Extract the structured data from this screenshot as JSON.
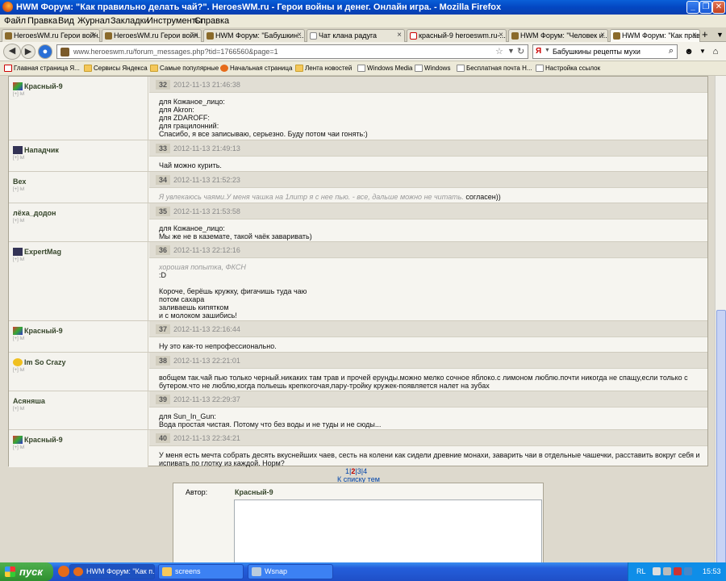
{
  "window": {
    "title": "HWM Форум: \"Как правильно делать чай?\". HeroesWM.ru - Герои войны и денег. Онлайн игра. - Mozilla Firefox"
  },
  "menu": [
    "Файл",
    "Правка",
    "Вид",
    "Журнал",
    "Закладки",
    "Инструменты",
    "Справка"
  ],
  "tabs": [
    {
      "label": "HeroesWM.ru Герои войн...",
      "active": false
    },
    {
      "label": "HeroesWM.ru Герои войн...",
      "active": false
    },
    {
      "label": "HWM Форум: \"Бабушкин...",
      "active": false
    },
    {
      "label": "Чат клана радуга",
      "active": false
    },
    {
      "label": "красный-9 heroeswm.ru-...",
      "active": false
    },
    {
      "label": "HWM Форум: \"Человек и...",
      "active": false
    },
    {
      "label": "HWM Форум: \"Как прави...",
      "active": true
    }
  ],
  "nav": {
    "url": "www.heroeswm.ru/forum_messages.php?tid=1766560&page=1",
    "search_value": "Бабушкины рецепты мухи"
  },
  "bookmarks": [
    "Главная страница Я...",
    "Сервисы Яндекса",
    "Самые популярные",
    "Начальная страница",
    "Лента новостей",
    "Windows Media",
    "Windows",
    "Бесплатная почта Н...",
    "Настройка ссылок"
  ],
  "posts": [
    {
      "author": "Красный-9",
      "level": "[+] lvl",
      "num": "32",
      "date": "2012-11-13 21:46:38",
      "lines": [
        "для Кожаное_лицо:",
        "для Akron:",
        "для ZDAROFF:",
        "для грацилонний:",
        "Спасибо, я все записываю, серьезно. Буду потом чаи гонять:)"
      ]
    },
    {
      "author": "Нападчик",
      "level": "[+] lvl",
      "num": "33",
      "date": "2012-11-13 21:49:13",
      "lines": [
        "Чай можно курить."
      ]
    },
    {
      "author": "Вех",
      "level": "[+] lvl",
      "num": "34",
      "date": "2012-11-13 21:52:23",
      "quote": "Я увлекаюсь чаями.У меня чашка на 1литр я с нее пью. - все, дальше можно не читать.",
      "lines": [
        " согласен))"
      ]
    },
    {
      "author": "лёха_додон",
      "level": "[+] lvl",
      "num": "35",
      "date": "2012-11-13 21:53:58",
      "lines": [
        "для Кожаное_лицо:",
        "Мы же не в каземате, такой чаёк заваривать)"
      ]
    },
    {
      "author": "ExpertMag",
      "level": "[+] lvl",
      "num": "36",
      "date": "2012-11-13 22:12:16",
      "quote": "хорошая попытка, ФКСН",
      "lines": [
        ":D",
        "",
        "Короче, берёшь кружку, фигачишь туда чаю",
        "потом сахара",
        "заливаешь кипятком",
        "и с молоком зашибись!"
      ]
    },
    {
      "author": "Красный-9",
      "level": "[+] lvl",
      "num": "37",
      "date": "2012-11-13 22:16:44",
      "lines": [
        "Ну это как-то непрофессионально."
      ]
    },
    {
      "author": "Im So Crazy",
      "level": "[+] lvl",
      "num": "38",
      "date": "2012-11-13 22:21:01",
      "lines": [
        "вобщем так.чай пью только черный.никаких там трав и прочей ерунды.можно мелко сочное яблоко.с лимоном люблю.почти никогда не спащу,если только с бутером.что не люблю,когда польешь крепкогочая,пару-тройку кружек-появляется налет на зубах"
      ]
    },
    {
      "author": "Асяняша",
      "level": "[+] lvl",
      "num": "39",
      "date": "2012-11-13 22:29:37",
      "lines": [
        "для Sun_In_Gun:",
        "Вода простая чистая. Потому что без воды и не туды и не сюды..."
      ]
    },
    {
      "author": "Красный-9",
      "level": "[+] lvl",
      "num": "40",
      "date": "2012-11-13 22:34:21",
      "lines": [
        "У меня есть мечта собрать десять вкуснейших чаев, сесть на колени как сидели древние монахи, заварить чаи в отдельные чашечки, расставить вокруг себя и испивать по глотку из каждой. Норм?"
      ]
    }
  ],
  "pager": {
    "p1": "1",
    "p2": "2",
    "p3": "3",
    "p4": "4",
    "back": "К списку тем"
  },
  "reply": {
    "author_label": "Автор:",
    "author_value": "Красный-9"
  },
  "taskbar": {
    "start": "пуск",
    "tasks": [
      "HWM Форум: \"Как п...",
      "screens",
      "Wsnap"
    ],
    "lang": "RL",
    "clock": "15:53"
  }
}
